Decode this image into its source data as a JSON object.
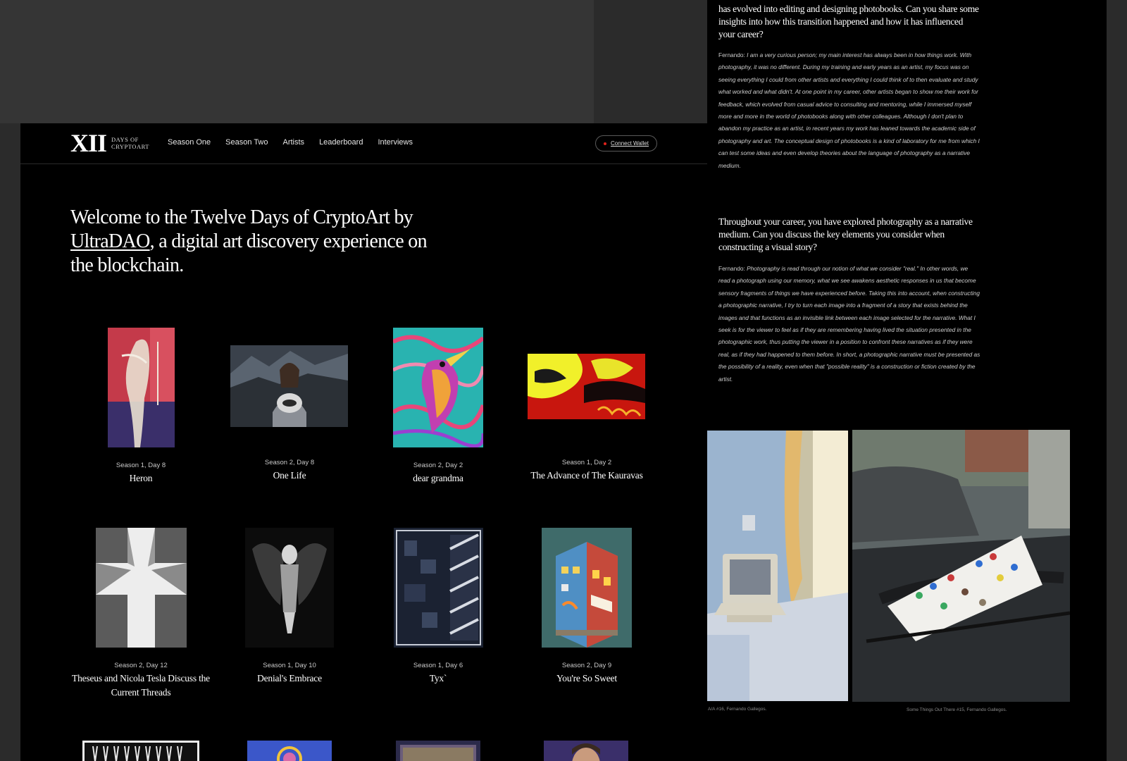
{
  "site": {
    "logo_mark": "XII",
    "logo_subtitle": "DAYS OF CRYPTOART",
    "nav": [
      "Season One",
      "Season Two",
      "Artists",
      "Leaderboard",
      "Interviews"
    ],
    "wallet_button": "Connect Wallet",
    "hero": {
      "text_before": "Welcome to the Twelve Days of CryptoArt by ",
      "link": "UltraDAO",
      "text_after": ", a digital art discovery experience on the blockchain."
    },
    "cards": [
      {
        "meta": "Season 1, Day 8",
        "title": "Heron"
      },
      {
        "meta": "Season 2, Day 8",
        "title": "One Life"
      },
      {
        "meta": "Season 2, Day 2",
        "title": "dear grandma"
      },
      {
        "meta": "Season 1, Day 2",
        "title": "The Advance of The Kauravas"
      },
      {
        "meta": "Season 2, Day 12",
        "title": "Theseus and Nicola Tesla Discuss the Current Threads"
      },
      {
        "meta": "Season 1, Day 10",
        "title": "Denial's Embrace"
      },
      {
        "meta": "Season 1, Day 6",
        "title": "Tyx`"
      },
      {
        "meta": "Season 2, Day 9",
        "title": "You're So Sweet"
      }
    ]
  },
  "article": {
    "q1_tail": "has evolved into editing and designing photobooks. Can you share some insights into how this transition happened and how it has influenced your career?",
    "a1": {
      "speaker": "Fernando: ",
      "text": "I am a very curious person; my main interest has always been in how things work. With photography, it was no different. During my training and early years as an artist, my focus was on seeing everything I could from other artists and everything I could think of to then evaluate and study what worked and what didn't. At one point in my career, other artists began to show me their work for feedback, which evolved from casual advice to consulting and mentoring, while I immersed myself more and more in the world of photobooks along with other colleagues. Although I don't plan to abandon my practice as an artist, in recent years my work has leaned towards the academic side of photography and art. The conceptual design of photobooks is a kind of laboratory for me from which I can test some ideas and even develop theories about the language of photography as a narrative medium."
    },
    "q2": "Throughout your career, you have explored photography as a narrative medium. Can you discuss the key elements you consider when constructing a visual story?",
    "a2": {
      "speaker": "Fernando: ",
      "text": "Photography is read through our notion of what we consider \"real.\" In other words, we read a photograph using our memory, what we see awakens aesthetic responses in us that become sensory fragments of things we have experienced before. Taking this into account, when constructing a photographic narrative, I try to turn each image into a fragment of a story that exists behind the images and that functions as an invisible link between each image selected for the narrative. What I seek is for the viewer to feel as if they are remembering having lived the situation presented in the photographic work, thus putting the viewer in a position to confront these narratives as if they were real, as if they had happened to them before. In short, a photographic narrative must be presented as the possibility of a reality, even when that \"possible reality\" is a construction or fiction created by the artist."
    },
    "captions": [
      "A/A #16, Fernando Gallegos.",
      "Some Things Out There #15, Fernando Gallegos."
    ]
  }
}
